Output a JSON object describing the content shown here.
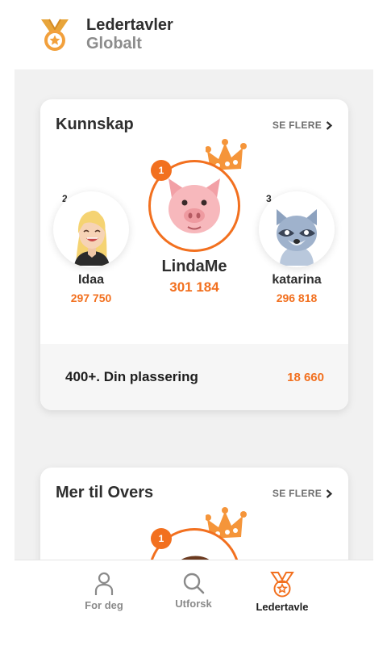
{
  "header": {
    "title": "Ledertavler",
    "subtitle": "Globalt",
    "icon": "medal-icon"
  },
  "colors": {
    "accent": "#f2701f",
    "crown": "#f5953a",
    "background": "#f1f1f1"
  },
  "leaderboards": [
    {
      "title": "Kunnskap",
      "see_more": "SE FLERE",
      "podium": [
        {
          "rank": "2",
          "name": "Idaa",
          "score": "297 750",
          "avatar": "blonde-woman-avatar"
        },
        {
          "rank": "1",
          "name": "LindaMe",
          "score": "301 184",
          "avatar": "pig-avatar"
        },
        {
          "rank": "3",
          "name": "katarina",
          "score": "296 818",
          "avatar": "raccoon-avatar"
        }
      ],
      "my_rank": "400+. Din plassering",
      "my_score": "18 660"
    },
    {
      "title": "Mer til Overs",
      "see_more": "SE FLERE",
      "podium": [
        {
          "rank": "1",
          "avatar": "man-avatar"
        }
      ]
    }
  ],
  "nav": {
    "items": [
      {
        "label": "For deg",
        "icon": "person-icon",
        "active": false
      },
      {
        "label": "Utforsk",
        "icon": "search-icon",
        "active": false
      },
      {
        "label": "Ledertavle",
        "icon": "medal-icon",
        "active": true
      }
    ]
  }
}
